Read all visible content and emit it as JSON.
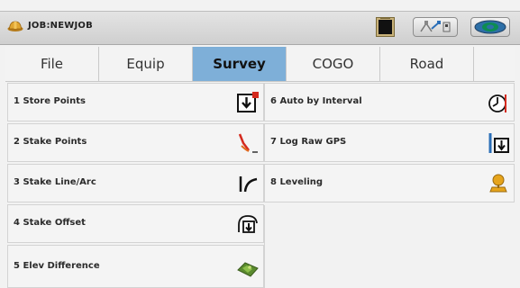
{
  "titlebar": {
    "job_title": "JOB:NEWJOB",
    "icons": [
      "helmet-icon",
      "sim-card-icon",
      "gps-status-icon",
      "network-icon"
    ]
  },
  "tabs": [
    {
      "label": "File",
      "active": false
    },
    {
      "label": "Equip",
      "active": false
    },
    {
      "label": "Survey",
      "active": true
    },
    {
      "label": "COGO",
      "active": false
    },
    {
      "label": "Road",
      "active": false
    }
  ],
  "menu": {
    "left": [
      {
        "label": "1 Store Points",
        "icon": "store-points-icon"
      },
      {
        "label": "2 Stake Points",
        "icon": "stake-points-icon"
      },
      {
        "label": "3 Stake Line/Arc",
        "icon": "stake-line-arc-icon"
      },
      {
        "label": "4 Stake Offset",
        "icon": "stake-offset-icon"
      },
      {
        "label": "5 Elev Difference",
        "icon": "elev-difference-icon"
      }
    ],
    "right": [
      {
        "label": "6 Auto by Interval",
        "icon": "auto-interval-icon"
      },
      {
        "label": "7 Log Raw GPS",
        "icon": "log-raw-gps-icon"
      },
      {
        "label": "8 Leveling",
        "icon": "leveling-icon"
      }
    ]
  },
  "colors": {
    "active_tab": "#7eafd8",
    "icon_red": "#d42a1e",
    "icon_blue": "#2b6fb8"
  }
}
